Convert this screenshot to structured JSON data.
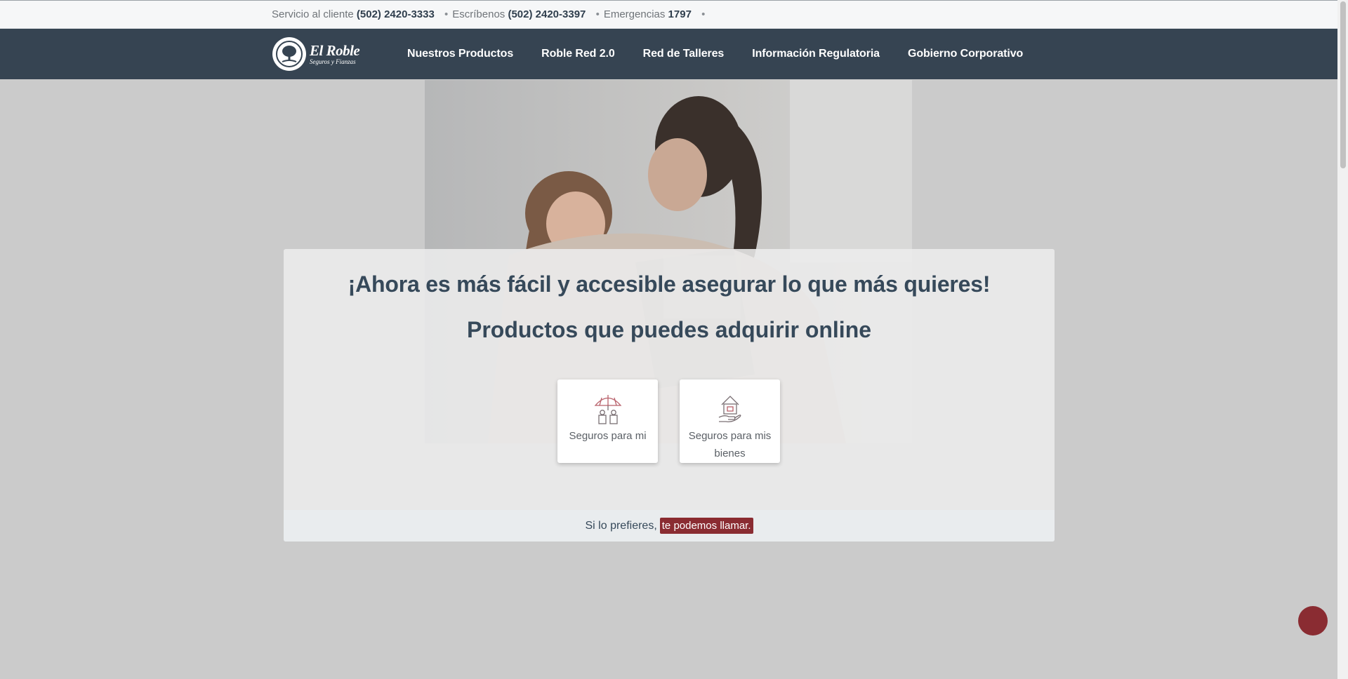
{
  "topbar": {
    "service_label": "Servicio al cliente",
    "service_number": "(502) 2420-3333",
    "write_label": "Escríbenos",
    "write_number": "(502) 2420-3397",
    "emergency_label": "Emergencias",
    "emergency_number": "1797",
    "bullet": "•"
  },
  "logo": {
    "brand": "El Roble",
    "tagline": "Seguros y Fianzas"
  },
  "nav": {
    "items": [
      {
        "label": "Nuestros Productos"
      },
      {
        "label": "Roble Red 2.0"
      },
      {
        "label": "Red de Talleres"
      },
      {
        "label": "Información Regulatoria"
      },
      {
        "label": "Gobierno Corporativo"
      }
    ]
  },
  "hero": {
    "headline": "¡Ahora es más fácil y accesible asegurar lo que más quieres!",
    "subheadline": "Productos que puedes adquirir online",
    "cards": [
      {
        "label": "Seguros para mi",
        "icon": "family-umbrella-icon"
      },
      {
        "label": "Seguros para mis bienes",
        "icon": "house-hand-icon"
      }
    ],
    "call_text": "Si lo prefieres,",
    "call_link": "te podemos llamar."
  },
  "colors": {
    "nav_bg": "#364452",
    "accent": "#8a2c32",
    "heading": "#36495a"
  }
}
